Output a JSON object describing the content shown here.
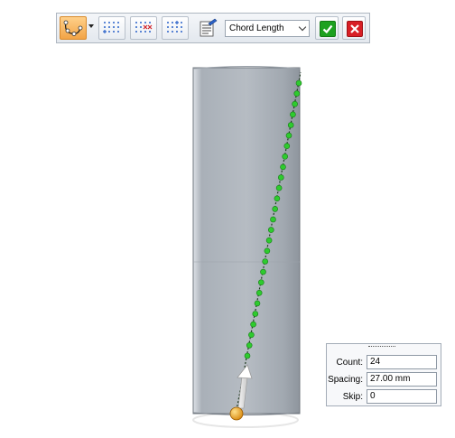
{
  "toolbar": {
    "buttons": [
      {
        "name": "path-pattern",
        "icon": "path-curve-icon",
        "active": true
      },
      {
        "name": "grid-fill",
        "icon": "dot-grid-icon"
      },
      {
        "name": "grid-remove",
        "icon": "dot-grid-remove-icon"
      },
      {
        "name": "grid-add",
        "icon": "dot-grid-add-icon"
      },
      {
        "name": "table-sheet",
        "icon": "sheet-edit-icon"
      }
    ],
    "spacing_mode": "Chord Length",
    "accept_icon": "check-icon",
    "cancel_icon": "x-icon",
    "colors": {
      "accept": "#1da11f",
      "cancel": "#d81f26",
      "active_button": "#f2a446"
    }
  },
  "panel": {
    "count_label": "Count:",
    "count_value": "24",
    "spacing_label": "Spacing:",
    "spacing_value": "27.00 mm",
    "skip_label": "Skip:",
    "skip_value": "0"
  },
  "model": {
    "pattern_count": 24,
    "cylinder_color": "#aeb5bd",
    "dot_color": "#2ecb2e",
    "handle_color": "#f0a020"
  }
}
